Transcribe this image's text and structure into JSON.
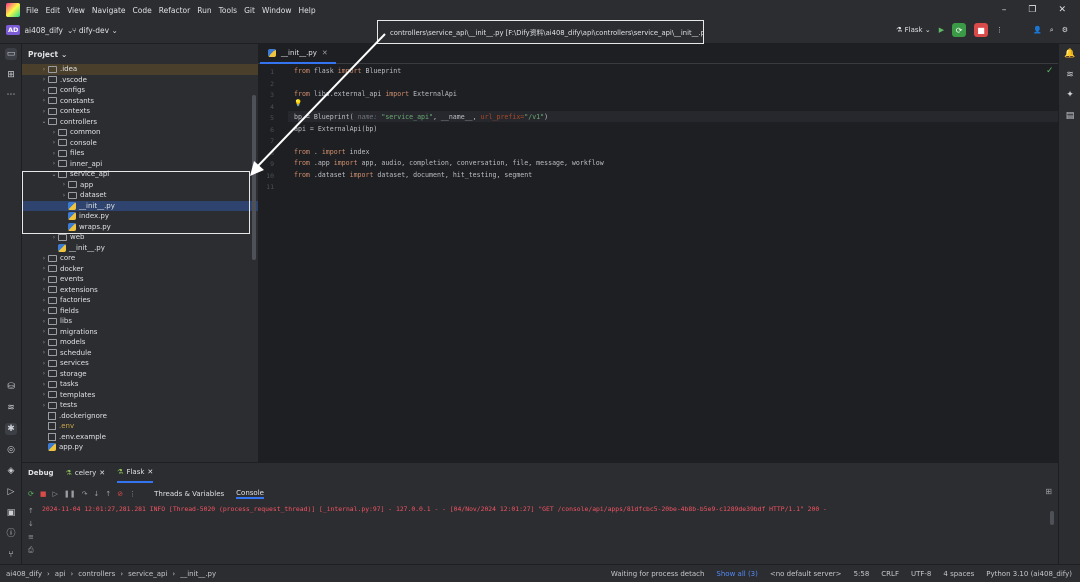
{
  "menu": [
    "File",
    "Edit",
    "View",
    "Navigate",
    "Code",
    "Refactor",
    "Run",
    "Tools",
    "Git",
    "Window",
    "Help"
  ],
  "window_controls": [
    "–",
    "❐",
    "✕"
  ],
  "project": {
    "badge": "AD",
    "name": "ai408_dify",
    "branch": "dify-dev"
  },
  "path_box": "controllers\\service_api\\__init__.py [F:\\Dify资料\\ai408_dify\\api\\controllers\\service_api\\__init__.py]",
  "run_config": "Flask",
  "panel_title": "Project",
  "tree": [
    {
      "depth": 2,
      "kind": "folder",
      "label": ".idea",
      "open": false,
      "hl": true
    },
    {
      "depth": 2,
      "kind": "folder",
      "label": ".vscode",
      "open": false
    },
    {
      "depth": 2,
      "kind": "folder",
      "label": "configs",
      "open": false
    },
    {
      "depth": 2,
      "kind": "folder",
      "label": "constants",
      "open": false
    },
    {
      "depth": 2,
      "kind": "folder",
      "label": "contexts",
      "open": false
    },
    {
      "depth": 2,
      "kind": "folder",
      "label": "controllers",
      "open": true
    },
    {
      "depth": 3,
      "kind": "folder",
      "label": "common",
      "open": false
    },
    {
      "depth": 3,
      "kind": "folder",
      "label": "console",
      "open": false
    },
    {
      "depth": 3,
      "kind": "folder",
      "label": "files",
      "open": false
    },
    {
      "depth": 3,
      "kind": "folder",
      "label": "inner_api",
      "open": false
    },
    {
      "depth": 3,
      "kind": "folder",
      "label": "service_api",
      "open": true
    },
    {
      "depth": 4,
      "kind": "folder",
      "label": "app",
      "open": false
    },
    {
      "depth": 4,
      "kind": "folder",
      "label": "dataset",
      "open": false
    },
    {
      "depth": 4,
      "kind": "py",
      "label": "__init__.py",
      "sel": true
    },
    {
      "depth": 4,
      "kind": "py",
      "label": "index.py"
    },
    {
      "depth": 4,
      "kind": "py",
      "label": "wraps.py"
    },
    {
      "depth": 3,
      "kind": "folder",
      "label": "web",
      "open": false
    },
    {
      "depth": 3,
      "kind": "py",
      "label": "__init__.py"
    },
    {
      "depth": 2,
      "kind": "folder",
      "label": "core",
      "open": false
    },
    {
      "depth": 2,
      "kind": "folder",
      "label": "docker",
      "open": false
    },
    {
      "depth": 2,
      "kind": "folder",
      "label": "events",
      "open": false
    },
    {
      "depth": 2,
      "kind": "folder",
      "label": "extensions",
      "open": false
    },
    {
      "depth": 2,
      "kind": "folder",
      "label": "factories",
      "open": false
    },
    {
      "depth": 2,
      "kind": "folder",
      "label": "fields",
      "open": false
    },
    {
      "depth": 2,
      "kind": "folder",
      "label": "libs",
      "open": false
    },
    {
      "depth": 2,
      "kind": "folder",
      "label": "migrations",
      "open": false
    },
    {
      "depth": 2,
      "kind": "folder",
      "label": "models",
      "open": false
    },
    {
      "depth": 2,
      "kind": "folder",
      "label": "schedule",
      "open": false
    },
    {
      "depth": 2,
      "kind": "folder",
      "label": "services",
      "open": false
    },
    {
      "depth": 2,
      "kind": "folder",
      "label": "storage",
      "open": false
    },
    {
      "depth": 2,
      "kind": "folder",
      "label": "tasks",
      "open": false
    },
    {
      "depth": 2,
      "kind": "folder",
      "label": "templates",
      "open": false
    },
    {
      "depth": 2,
      "kind": "folder",
      "label": "tests",
      "open": false
    },
    {
      "depth": 2,
      "kind": "file",
      "label": ".dockerignore"
    },
    {
      "depth": 2,
      "kind": "file",
      "label": ".env",
      "hlText": true
    },
    {
      "depth": 2,
      "kind": "file",
      "label": ".env.example"
    },
    {
      "depth": 2,
      "kind": "py",
      "label": "app.py"
    }
  ],
  "editor_tab": "__init__.py",
  "code": {
    "l1": {
      "kw": "from",
      "a": " flask ",
      "kw2": "import",
      "b": " Blueprint"
    },
    "l3": {
      "kw": "from",
      "a": " libs.external_api ",
      "kw2": "import",
      "b": " ExternalApi"
    },
    "l5a": "bp = Blueprint(",
    "l5hint": " name: ",
    "l5s1": "\"service_api\"",
    "l5b": ", __name__, ",
    "l5hint2": "url_prefix=",
    "l5s2": "\"/v1\"",
    "l5c": ")",
    "l6": "api = ExternalApi(bp)",
    "l8": {
      "kw": "from",
      ".": " . ",
      "kw2": "import",
      "b": " index"
    },
    "l9": {
      "kw": "from",
      "a": " .app ",
      "kw2": "import",
      "b": " app, audio, completion, conversation, file, message, workflow"
    },
    "l10": {
      "kw": "from",
      "a": " .dataset ",
      "kw2": "import",
      "b": " dataset, document, hit_testing, segment"
    }
  },
  "line_numbers": [
    "1",
    "2",
    "3",
    "4",
    "5",
    "6",
    "7",
    "8",
    "9",
    "10",
    "11"
  ],
  "debug": {
    "title": "Debug",
    "tabs": [
      "celery",
      "Flask"
    ],
    "subtabs": [
      "Threads & Variables",
      "Console"
    ],
    "log": "2024-11-04 12:01:27,281.281 INFO [Thread-5020 (process_request_thread)] [_internal.py:97] - 127.0.0.1 - - [04/Nov/2024 12:01:27] \"GET /console/api/apps/81dfcbc5-20be-4b8b-b5e9-c1289de39bdf HTTP/1.1\" 200 -"
  },
  "status": {
    "crumbs": [
      "ai408_dify",
      "api",
      "controllers",
      "service_api",
      "__init__.py"
    ],
    "right": [
      "Waiting for process detach",
      "Show all (3)",
      "<no default server>",
      "5:58",
      "CRLF",
      "UTF-8",
      "4 spaces",
      "Python 3.10 (ai408_dify)"
    ]
  }
}
